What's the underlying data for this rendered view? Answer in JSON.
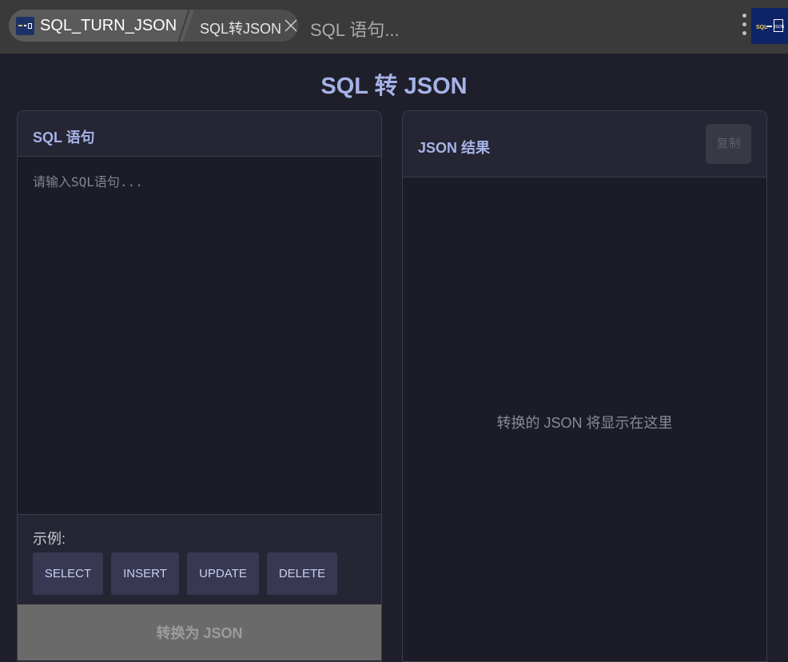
{
  "topbar": {
    "app_title": "SQL_TURN_JSON",
    "page_title": "SQL转JSON",
    "hint": "SQL 语句..."
  },
  "main": {
    "title": "SQL 转 JSON",
    "sql_panel": {
      "heading": "SQL 语句",
      "placeholder": "请输入SQL语句...",
      "value": "",
      "examples_label": "示例:",
      "examples": [
        "SELECT",
        "INSERT",
        "UPDATE",
        "DELETE"
      ],
      "convert_label": "转换为 JSON"
    },
    "json_panel": {
      "heading": "JSON 结果",
      "copy_label": "复制",
      "empty_text": "转换的 JSON 将显示在这里"
    }
  },
  "colors": {
    "accent": "#a5b3e6",
    "background": "#1f1f2c",
    "panel": "#1c1c27",
    "panel_header": "#252533",
    "example_button": "#383852",
    "convert_button_disabled": "#6a6a6a"
  },
  "icons": {
    "app_logo": "app-logo-icon",
    "close": "close-icon",
    "more": "kebab-menu-icon",
    "brand": "sql-to-json-logo-icon"
  }
}
